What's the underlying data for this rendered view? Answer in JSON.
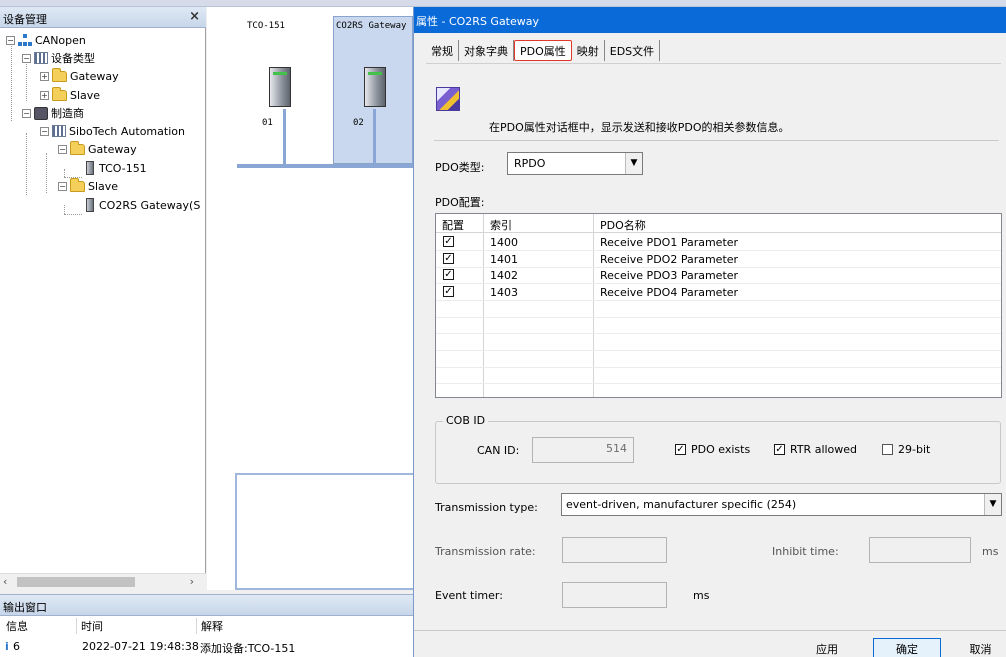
{
  "left_panel": {
    "title": "设备管理",
    "close_glyph": "×",
    "tree": [
      {
        "label": "CANopen",
        "icon": "network-icon",
        "toggle": "−"
      },
      {
        "label": "设备类型",
        "icon": "category-icon",
        "toggle": "−"
      },
      {
        "label": "Gateway",
        "icon": "folder-icon",
        "toggle": "+"
      },
      {
        "label": "Slave",
        "icon": "folder-icon",
        "toggle": "+"
      },
      {
        "label": "制造商",
        "icon": "manufacturer-icon",
        "toggle": "−"
      },
      {
        "label": "SiboTech Automation",
        "icon": "category-icon",
        "toggle": "−"
      },
      {
        "label": "Gateway",
        "icon": "folder-icon",
        "toggle": "−"
      },
      {
        "label": "TCO-151",
        "icon": "device-icon"
      },
      {
        "label": "Slave",
        "icon": "folder-icon",
        "toggle": "−"
      },
      {
        "label": "CO2RS Gateway(S",
        "icon": "device-icon"
      }
    ],
    "scroll_left": "‹",
    "scroll_right": "›"
  },
  "canvas": {
    "devices": [
      {
        "name": "TCO-151",
        "index": "01"
      },
      {
        "name": "CO2RS Gateway",
        "index": "02"
      }
    ]
  },
  "output": {
    "title": "输出窗口",
    "columns": [
      "信息",
      "时间",
      "解释"
    ],
    "rows": [
      {
        "info": "6",
        "time": "2022-07-21 19:48:38",
        "desc": "添加设备:TCO-151"
      }
    ]
  },
  "dialog": {
    "title": "属性 - CO2RS Gateway",
    "tabs": [
      "常规",
      "对象字典",
      "PDO属性",
      "映射",
      "EDS文件"
    ],
    "active_tab": "PDO属性",
    "description": "在PDO属性对话框中，显示发送和接收PDO的相关参数信息。",
    "pdo_type_label": "PDO类型:",
    "pdo_type_value": "RPDO",
    "pdo_config_label": "PDO配置:",
    "table_columns": [
      "配置",
      "索引",
      "PDO名称"
    ],
    "table_rows": [
      {
        "checked": true,
        "index": "1400",
        "name": "Receive PDO1 Parameter"
      },
      {
        "checked": true,
        "index": "1401",
        "name": "Receive PDO2 Parameter"
      },
      {
        "checked": true,
        "index": "1402",
        "name": "Receive PDO3 Parameter"
      },
      {
        "checked": true,
        "index": "1403",
        "name": "Receive PDO4 Parameter"
      }
    ],
    "cobid": {
      "legend": "COB ID",
      "can_id_label": "CAN ID:",
      "can_id_value": "514",
      "pdo_exists_label": "PDO exists",
      "pdo_exists_checked": true,
      "rtr_allowed_label": "RTR allowed",
      "rtr_allowed_checked": true,
      "bit29_label": "29-bit",
      "bit29_checked": false
    },
    "transmission_type_label": "Transmission type:",
    "transmission_type_value": "event-driven, manufacturer specific (254)",
    "transmission_rate_label": "Transmission rate:",
    "inhibit_time_label": "Inhibit time:",
    "inhibit_unit": "ms",
    "event_timer_label": "Event timer:",
    "event_unit": "ms",
    "buttons": {
      "apply": "应用",
      "ok": "确定",
      "cancel": "取消"
    }
  },
  "colors": {
    "accent": "#0a6ad8",
    "tab_highlight": "#e0392b"
  }
}
